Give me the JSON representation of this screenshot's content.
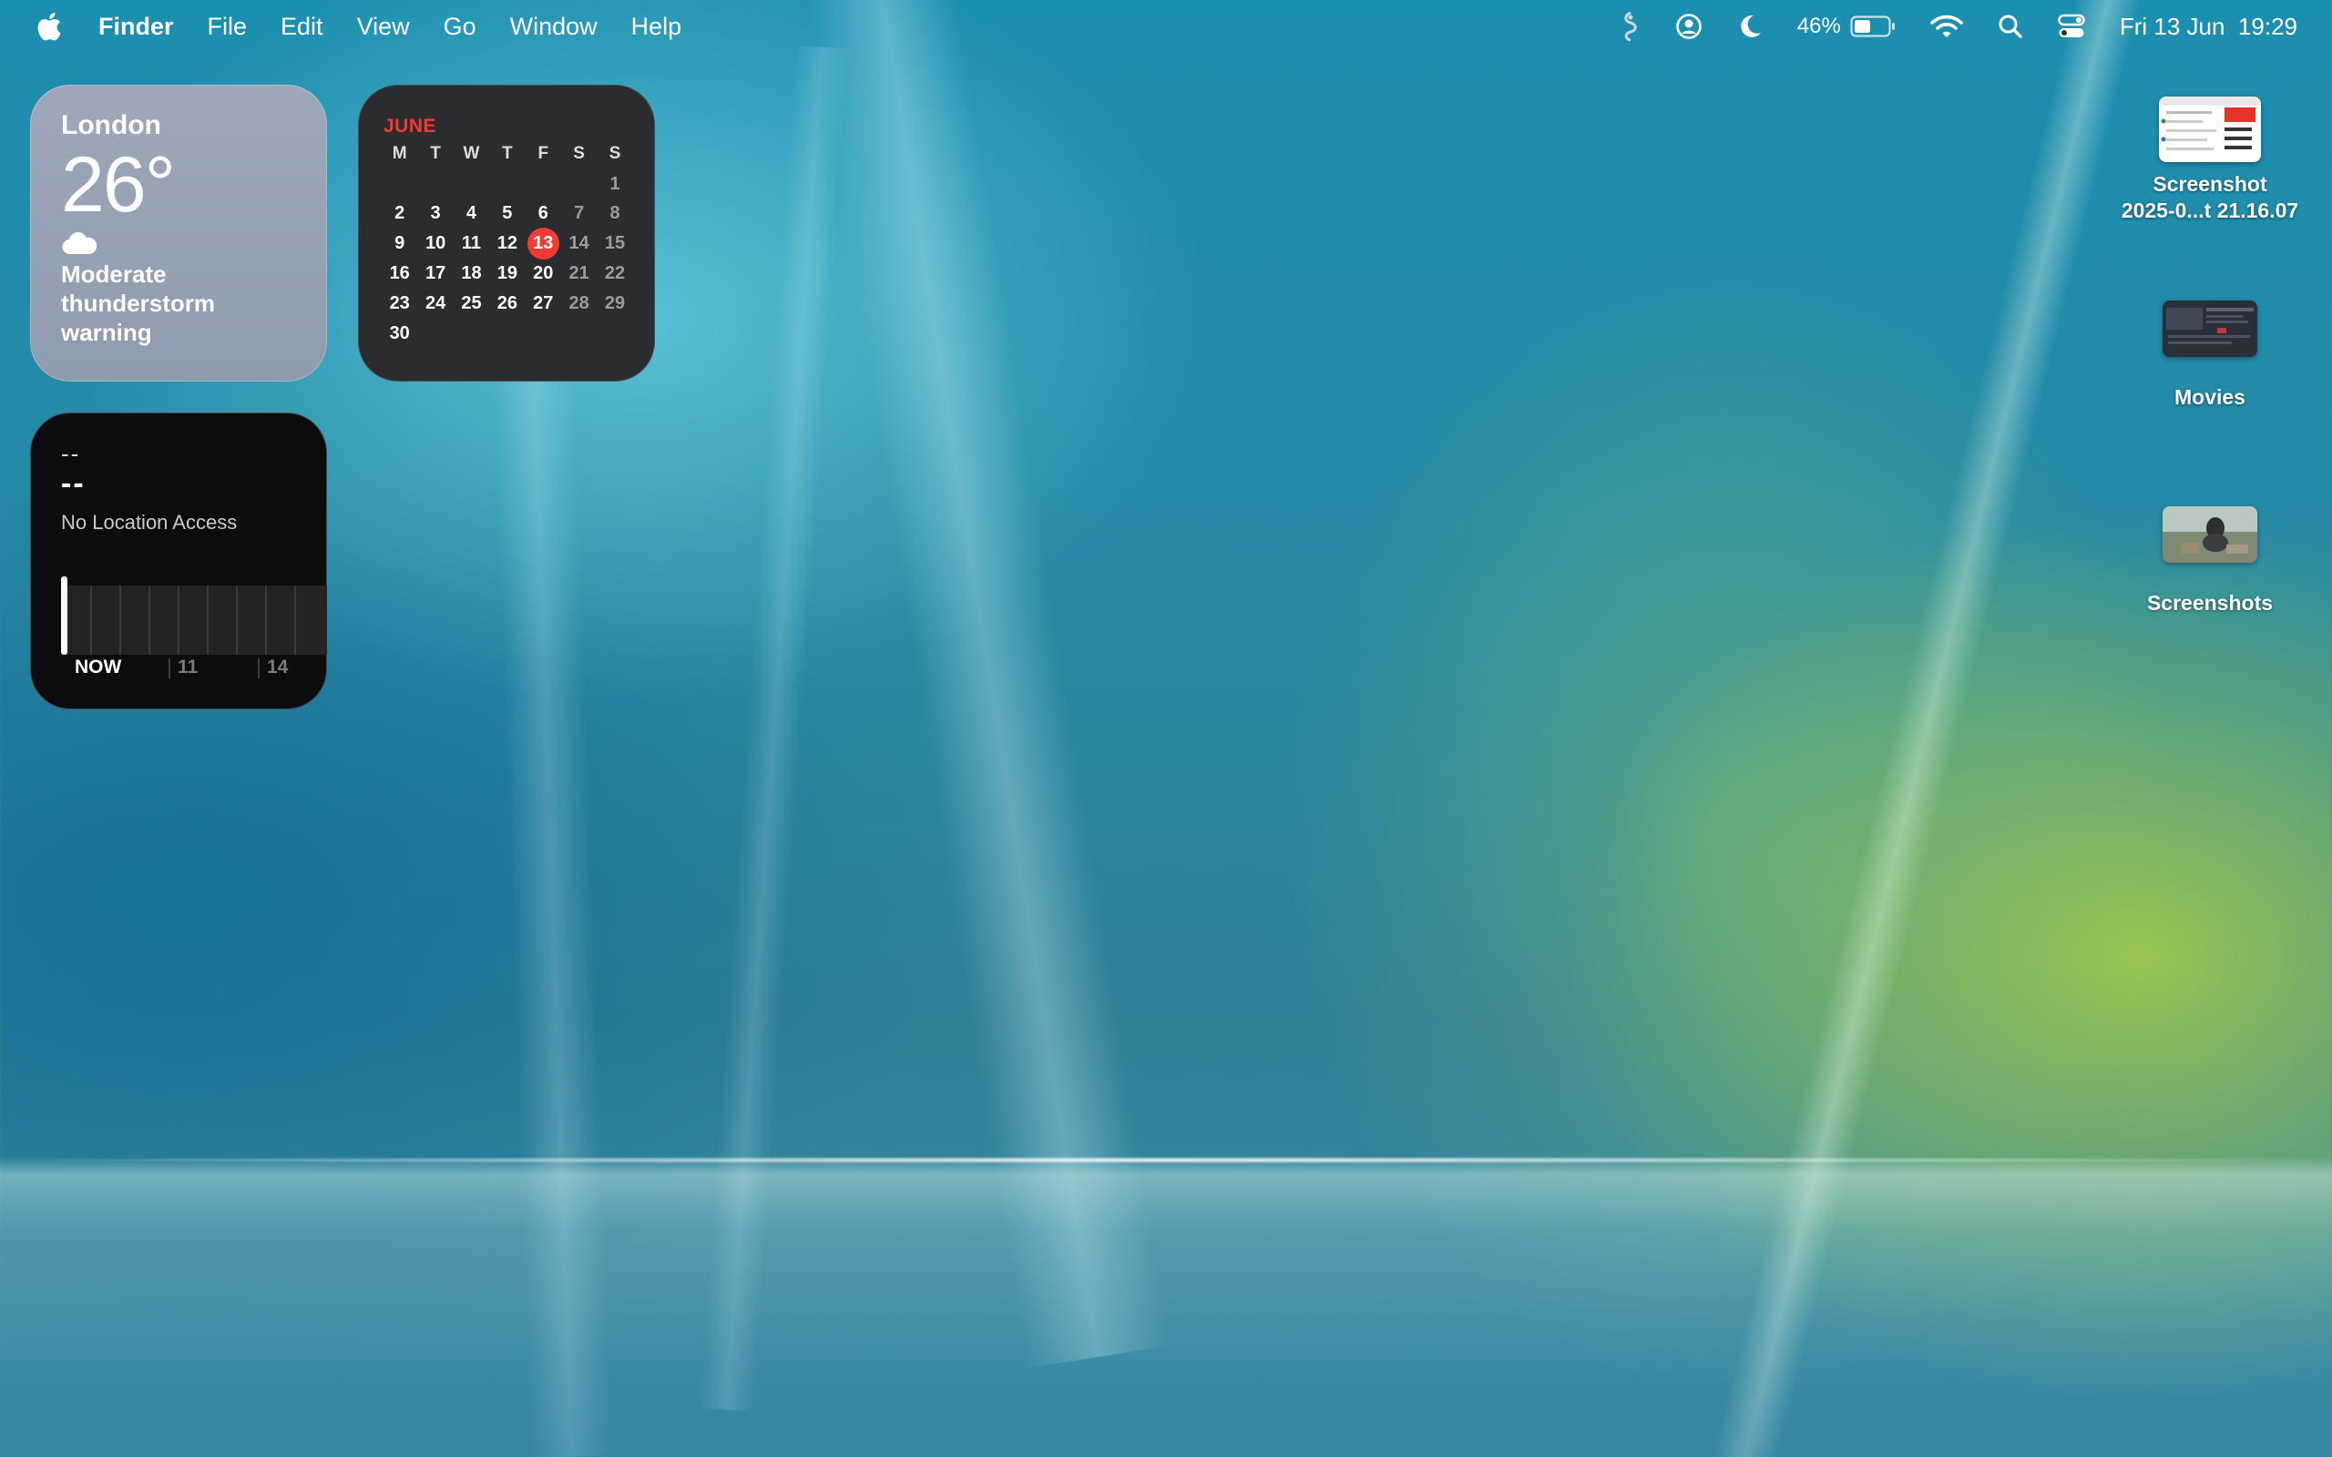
{
  "menubar": {
    "app_name": "Finder",
    "menus": [
      "File",
      "Edit",
      "View",
      "Go",
      "Window",
      "Help"
    ],
    "battery_percent": "46%",
    "datetime": "Fri 13 Jun  19:29",
    "icons": [
      "apple-logo-icon",
      "script-app-icon",
      "user-account-icon",
      "focus-moon-icon",
      "battery-icon",
      "wifi-icon",
      "spotlight-search-icon",
      "control-center-icon"
    ]
  },
  "weather_widget": {
    "city": "London",
    "temperature": "26°",
    "condition": "Moderate thunderstorm warning",
    "icon": "cloud-icon"
  },
  "calendar_widget": {
    "month": "JUNE",
    "weekdays": [
      "M",
      "T",
      "W",
      "T",
      "F",
      "S",
      "S"
    ],
    "leading_blanks": 6,
    "days_in_month": 30,
    "today": 13,
    "accent_color": "#f23b32"
  },
  "sun_widget": {
    "placeholder_small": "--",
    "placeholder_large": "--",
    "message": "No Location Access",
    "now_label": "NOW",
    "hour_labels": [
      "11",
      "14"
    ]
  },
  "desktop_items": [
    {
      "label_line1": "Screenshot",
      "label_line2": "2025-0...t 21.16.07",
      "icon": "screenshot-thumbnail-icon"
    },
    {
      "label_line1": "Movies",
      "label_line2": "",
      "icon": "folder-thumbnail-icon"
    },
    {
      "label_line1": "Screenshots",
      "label_line2": "",
      "icon": "folder-thumbnail-icon"
    }
  ]
}
